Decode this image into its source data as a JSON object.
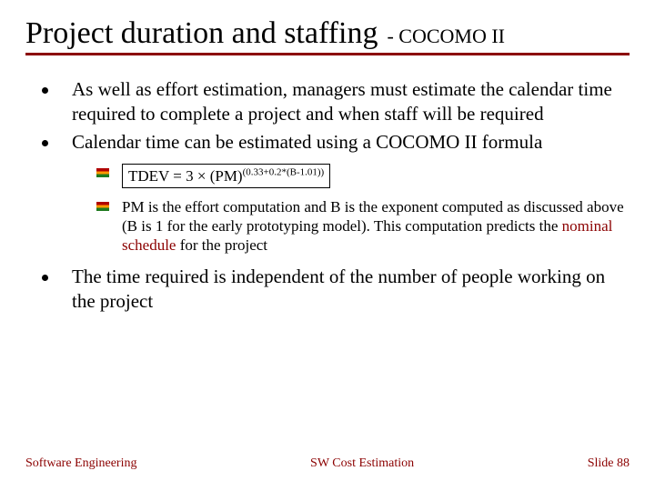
{
  "title": {
    "main": "Project duration and staffing",
    "sub": "- COCOMO II"
  },
  "bullets": {
    "b0": "As well as effort estimation, managers must estimate the calendar time required to complete a project and when staff will be required",
    "b1": "Calendar time can be estimated using a COCOMO II formula",
    "b2": "The time required is independent of the number of people working on the project"
  },
  "formula": {
    "lead": "TDEV = 3 ",
    "times": "×",
    "mid": " (PM)",
    "exp": "(0.33+0.2*(B-1.01))"
  },
  "sub_note": {
    "pre": "PM is the effort computation and B is the exponent computed as discussed above (B is 1 for the early prototyping model). This computation predicts the ",
    "hl": "nominal schedule",
    "post": " for the project"
  },
  "footer": {
    "left": "Software Engineering",
    "center": "SW Cost Estimation",
    "right": "Slide 88"
  }
}
